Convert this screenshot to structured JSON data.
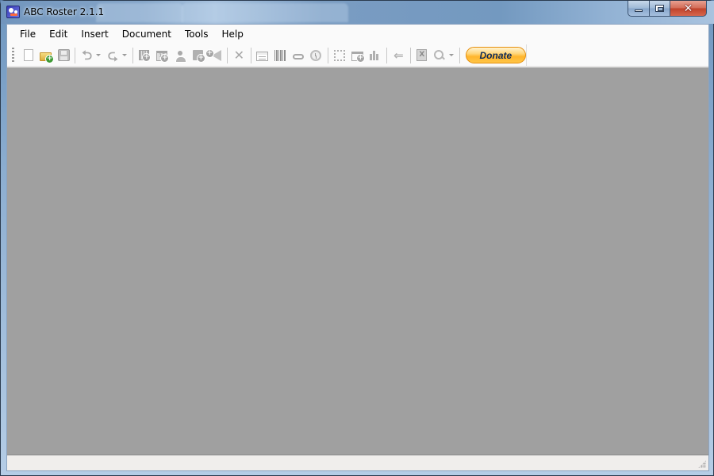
{
  "window": {
    "title": "ABC Roster 2.1.1",
    "controls": {
      "minimize": "minimize",
      "maximize": "maximize",
      "close": "✕"
    }
  },
  "menubar": {
    "items": [
      {
        "label": "File"
      },
      {
        "label": "Edit"
      },
      {
        "label": "Insert"
      },
      {
        "label": "Document"
      },
      {
        "label": "Tools"
      },
      {
        "label": "Help"
      }
    ]
  },
  "toolbar": {
    "groups": [
      [
        {
          "icon": "new-document-icon",
          "enabled": true
        },
        {
          "icon": "open-folder-icon",
          "enabled": true
        },
        {
          "icon": "save-icon",
          "enabled": false
        }
      ],
      [
        {
          "icon": "undo-icon",
          "enabled": false,
          "dropdown": true
        },
        {
          "icon": "redo-icon",
          "enabled": false,
          "dropdown": true
        }
      ],
      [
        {
          "icon": "add-roster-icon",
          "enabled": false
        },
        {
          "icon": "add-calendar-icon",
          "enabled": false,
          "text": "17"
        },
        {
          "icon": "add-person-icon",
          "enabled": false
        },
        {
          "icon": "add-shift-icon",
          "enabled": false
        },
        {
          "icon": "add-notification-icon",
          "enabled": false
        }
      ],
      [
        {
          "icon": "delete-icon",
          "enabled": false
        }
      ],
      [
        {
          "icon": "properties-card-icon",
          "enabled": false
        },
        {
          "icon": "barcode-icon",
          "enabled": false
        },
        {
          "icon": "link-icon",
          "enabled": false
        },
        {
          "icon": "clock-icon",
          "enabled": false
        }
      ],
      [
        {
          "icon": "fullscreen-icon",
          "enabled": false
        },
        {
          "icon": "new-window-icon",
          "enabled": false
        },
        {
          "icon": "bar-chart-icon",
          "enabled": false
        }
      ],
      [
        {
          "icon": "back-arrow-icon",
          "enabled": false
        }
      ],
      [
        {
          "icon": "excel-export-icon",
          "enabled": false,
          "text": "X"
        },
        {
          "icon": "zoom-icon",
          "enabled": false,
          "dropdown": true
        }
      ]
    ],
    "donate_label": "Donate",
    "undo_glyph": "⮌",
    "redo_glyph": "⮎",
    "delete_glyph": "✕",
    "back_glyph": "⇐"
  },
  "colors": {
    "workspace": "#a0a0a0",
    "donate_text": "#0d2a59",
    "donate_fill": "#ffb52c"
  }
}
